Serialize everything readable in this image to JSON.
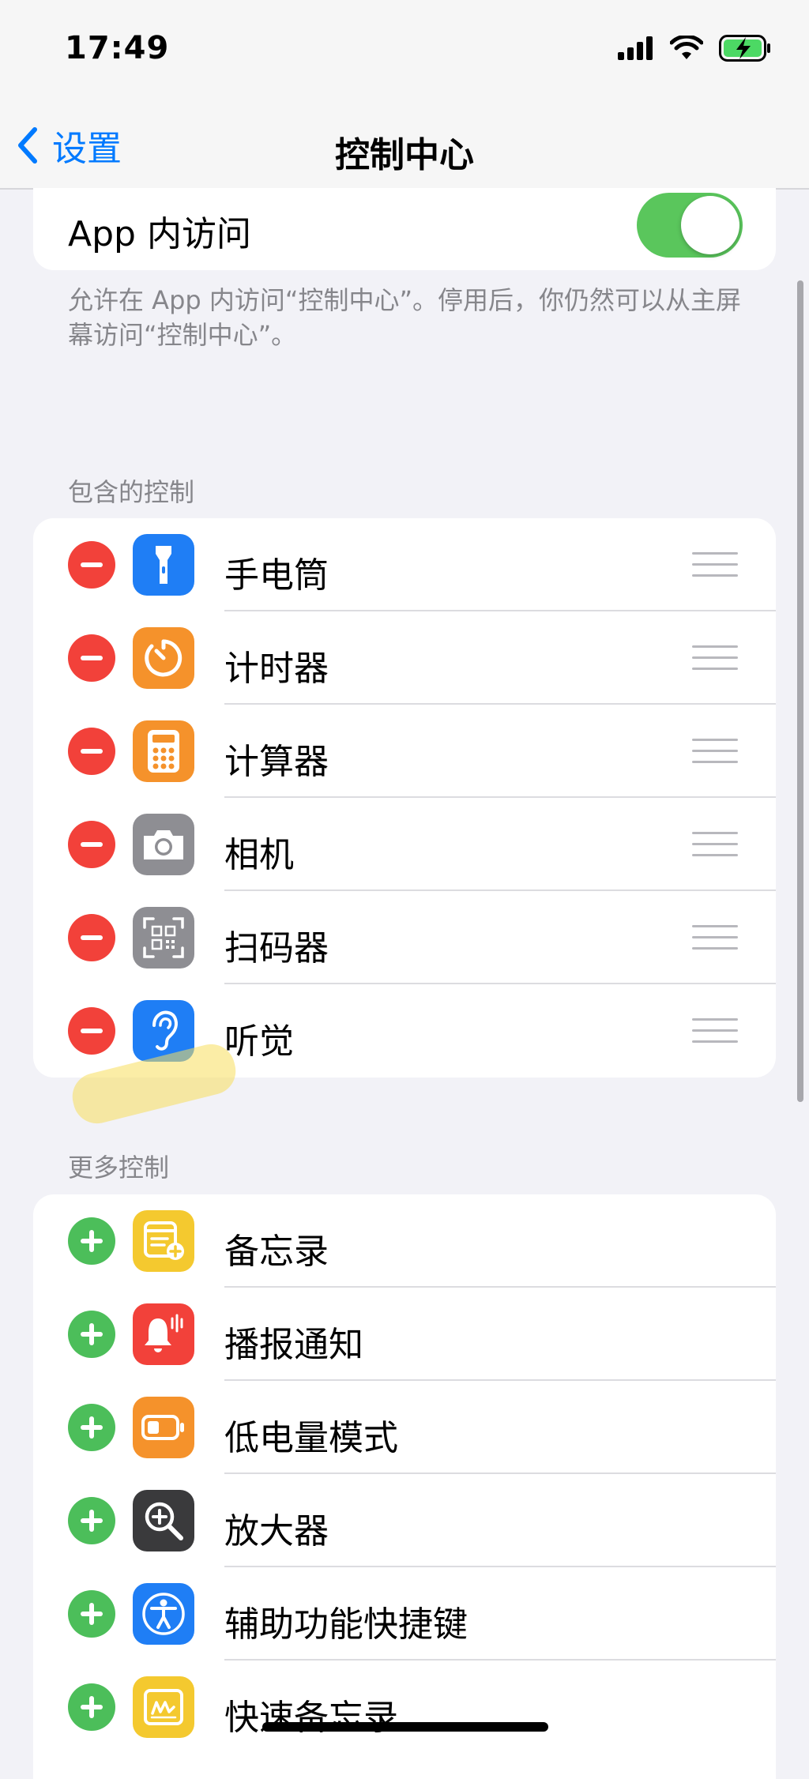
{
  "status": {
    "time": "17:49"
  },
  "nav": {
    "back_label": "设置",
    "title": "控制中心"
  },
  "in_app_access": {
    "label": "App 内访问",
    "enabled": true
  },
  "footnote": "允许在 App 内访问“控制中心”。停用后，你仍然可以从主屏幕访问“控制中心”。",
  "included_controls": {
    "header": "包含的控制",
    "items": [
      {
        "label": "手电筒",
        "icon": "flashlight-icon",
        "color": "#1f7ef5"
      },
      {
        "label": "计时器",
        "icon": "timer-icon",
        "color": "#f5922b"
      },
      {
        "label": "计算器",
        "icon": "calculator-icon",
        "color": "#f5922b"
      },
      {
        "label": "相机",
        "icon": "camera-icon",
        "color": "#8e8e93"
      },
      {
        "label": "扫码器",
        "icon": "qr-scanner-icon",
        "color": "#8e8e93"
      },
      {
        "label": "听觉",
        "icon": "ear-icon",
        "color": "#1f7ef5"
      }
    ]
  },
  "more_controls": {
    "header": "更多控制",
    "items": [
      {
        "label": "备忘录",
        "icon": "notes-icon",
        "color": "#f4c92f"
      },
      {
        "label": "播报通知",
        "icon": "announce-notifications-icon",
        "color": "#f2413a"
      },
      {
        "label": "低电量模式",
        "icon": "low-power-icon",
        "color": "#f5922b"
      },
      {
        "label": "放大器",
        "icon": "magnifier-icon",
        "color": "#3a3a3c"
      },
      {
        "label": "辅助功能快捷键",
        "icon": "accessibility-icon",
        "color": "#1f7ef5"
      },
      {
        "label": "快速备忘录",
        "icon": "quick-note-icon",
        "color": "#f4c92f"
      }
    ]
  }
}
